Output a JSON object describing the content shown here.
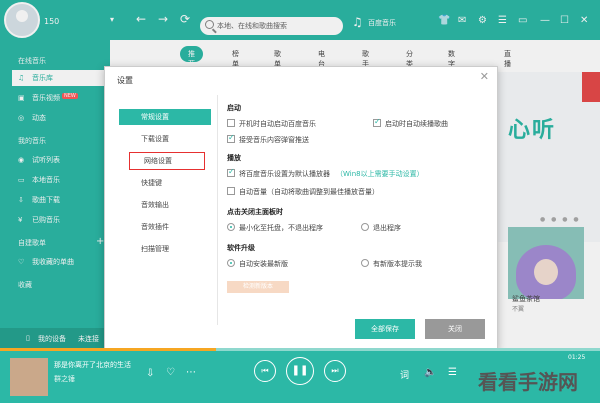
{
  "header": {
    "username": "150",
    "search_placeholder": "本地、在线和歌曲搜索",
    "brand": "百度音乐"
  },
  "sidebar": {
    "online_heading": "在线音乐",
    "online_items": [
      {
        "label": "音乐库",
        "icon": "music-note-icon",
        "active": true
      },
      {
        "label": "音乐视频",
        "icon": "video-icon",
        "badge": "NEW"
      },
      {
        "label": "动态",
        "icon": "dynamic-icon"
      }
    ],
    "my_heading": "我的音乐",
    "my_items": [
      {
        "label": "试听列表",
        "icon": "audio-icon"
      },
      {
        "label": "本地音乐",
        "icon": "monitor-icon"
      },
      {
        "label": "歌曲下载",
        "icon": "download-icon"
      },
      {
        "label": "已购音乐",
        "icon": "purchase-icon"
      }
    ],
    "created_heading": "自建歌单",
    "created_items": [
      {
        "label": "我收藏的单曲",
        "icon": "heart-icon"
      }
    ],
    "favorites_heading": "收藏",
    "bottom_device": "我的设备",
    "bottom_status": "未连接"
  },
  "main": {
    "tabs": [
      "推荐",
      "榜单",
      "歌单",
      "电台",
      "歌手",
      "分类",
      "数字专辑",
      "直播"
    ],
    "banner_text": "心听",
    "album_title": "鲨鱼茶馆",
    "album_artist": "不翼"
  },
  "dialog": {
    "title": "设置",
    "nav": [
      "常规设置",
      "下载设置",
      "网络设置",
      "快捷键",
      "音效输出",
      "音效插件",
      "扫描管理"
    ],
    "sections": {
      "startup": {
        "title": "启动",
        "opt1": "开机时自动启动百度音乐",
        "opt2": "启动时自动续播歌曲",
        "opt3": "接受音乐内容弹窗推送"
      },
      "playback": {
        "title": "播放",
        "opt1": "将百度音乐设置为默认播放器",
        "opt1_hint": "（Win8以上需要手动设置）",
        "opt2": "自动音量（自动将歌曲调整到最佳播放音量）"
      },
      "close": {
        "title": "点击关闭主面板时",
        "opt1": "最小化至托盘，不退出程序",
        "opt2": "退出程序"
      },
      "upgrade": {
        "title": "软件升级",
        "opt1": "自动安装最新版",
        "opt2": "有新版本提示我",
        "detect": "检测新版本"
      }
    },
    "save_label": "全部保存",
    "close_label": "关闭"
  },
  "player": {
    "song": "那是你离开了北京的生活",
    "artist": "群之锤",
    "time": "01:25",
    "progress": 0.36
  },
  "watermark": "看看手游网"
}
